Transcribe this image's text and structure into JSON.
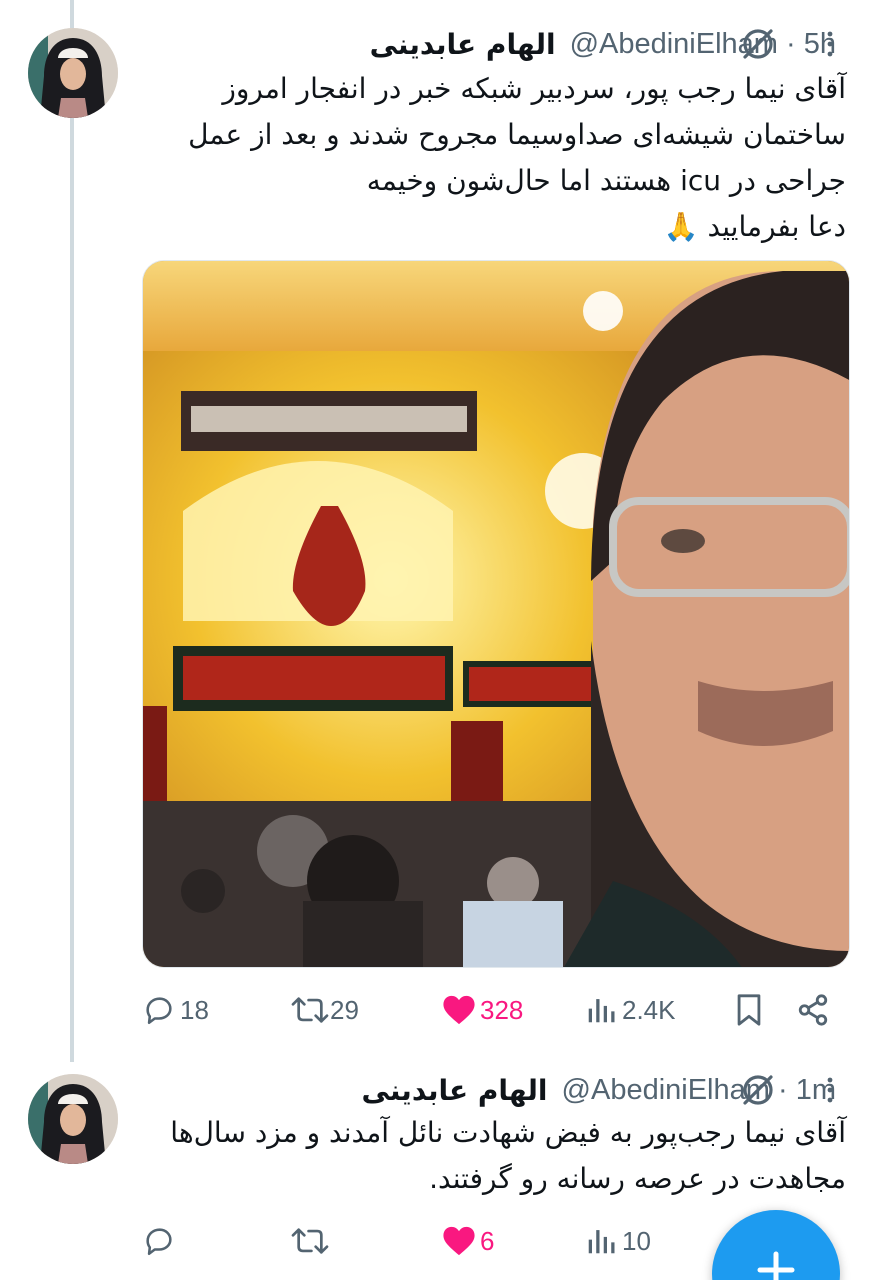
{
  "tweets": [
    {
      "display_name": "الهام عابدینی",
      "handle": "@AbediniElham",
      "time": "5h",
      "text_lines": [
        "آقای نیما رجب پور، سردبیر شبکه خبر در انفجار امروز",
        "ساختمان شیشه‌ای صداوسیما مجروح شدند و بعد از عمل",
        "جراحی در icu هستند اما حال‌شون وخیمه",
        "دعا بفرمایید 🙏"
      ],
      "media": "selfie-in-shrine-photo",
      "stats": {
        "replies": "18",
        "retweets": "29",
        "likes": "328",
        "views": "2.4K"
      }
    },
    {
      "display_name": "الهام عابدینی",
      "handle": "@AbediniElham",
      "time": "1m",
      "text_lines": [
        "آقای نیما رجب‌پور به فیض شهادت نائل آمدند و مزد سال‌ها",
        "مجاهدت در عرصه رسانه رو گرفتند."
      ],
      "stats": {
        "replies": "",
        "retweets": "",
        "likes": "6",
        "views": "10"
      }
    }
  ],
  "colors": {
    "accent": "#1d9bf0",
    "like": "#f91880",
    "muted": "#536471",
    "thread_line": "#cfd9de"
  }
}
